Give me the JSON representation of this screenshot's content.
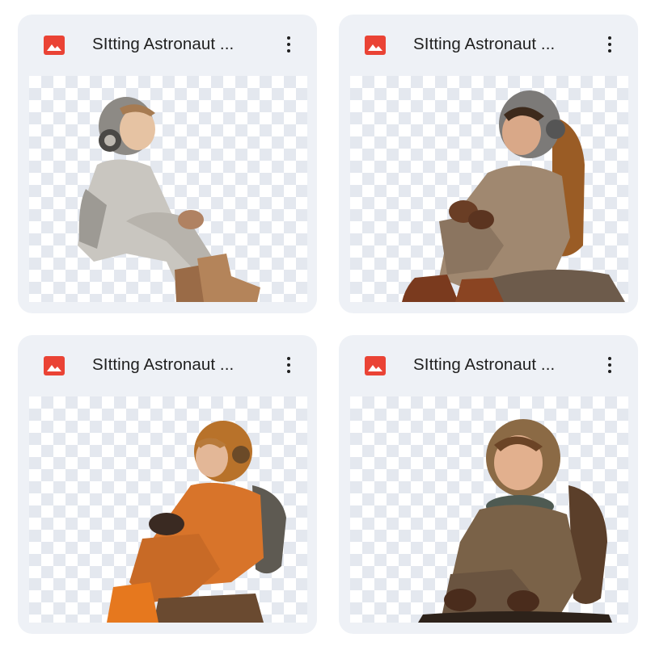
{
  "files": [
    {
      "title": "SItting Astronaut ...",
      "icon": "image-file-icon",
      "menu_icon": "more-vert-icon",
      "suit": "silver"
    },
    {
      "title": "SItting Astronaut ...",
      "icon": "image-file-icon",
      "menu_icon": "more-vert-icon",
      "suit": "tan"
    },
    {
      "title": "SItting Astronaut ...",
      "icon": "image-file-icon",
      "menu_icon": "more-vert-icon",
      "suit": "orange"
    },
    {
      "title": "SItting Astronaut ...",
      "icon": "image-file-icon",
      "menu_icon": "more-vert-icon",
      "suit": "brown"
    }
  ],
  "colors": {
    "card_bg": "#eef1f6",
    "icon_red": "#ea4335",
    "checker": "#e4e8ef",
    "text": "#1f1f1f"
  }
}
